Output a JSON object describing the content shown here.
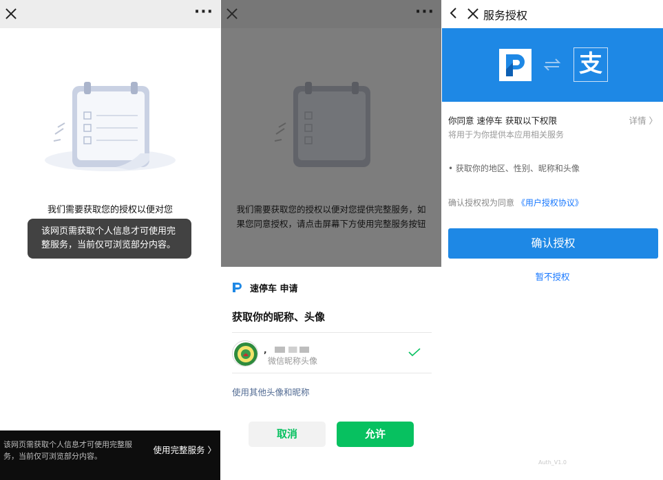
{
  "panel1": {
    "more_glyph": "···",
    "message": "我们需要获取您的授权以便对您",
    "toast": "该网页需获取个人信息才可使用完整服务，当前仅可浏览部分内容。",
    "bottom_text": "该网页需获取个人信息才可使用完整服务，当前仅可浏览部分内容。",
    "bottom_link": "使用完整服务 〉"
  },
  "panel2": {
    "more_glyph": "···",
    "message": "我们需要获取您的授权以便对您提供完整服务，如果您同意授权，请点击屏幕下方使用完整服务按钮",
    "app_name": "速停车 申请",
    "request_title": "获取你的昵称、头像",
    "nickname_prefix": ",",
    "nickname_sub": "微信昵称头像",
    "other_link": "使用其他头像和昵称",
    "cancel": "取消",
    "allow": "允许",
    "colors": {
      "green": "#07c160",
      "link": "#526b93"
    }
  },
  "panel3": {
    "title": "服务授权",
    "logo_zhi": "支",
    "agree_line": "你同意 速停车 获取以下权限",
    "details": "详情 〉",
    "use_for": "将用于为你提供本应用相关服务",
    "permission_item": "• 获取你的地区、性别、昵称和头像",
    "agreement_prefix": "确认授权视为同意",
    "agreement_link": "《用户授权协议》",
    "confirm": "确认授权",
    "not_now": "暂不授权",
    "version": "Auth_V1.0",
    "colors": {
      "brand": "#1e88e5",
      "link": "#1677ff"
    }
  }
}
